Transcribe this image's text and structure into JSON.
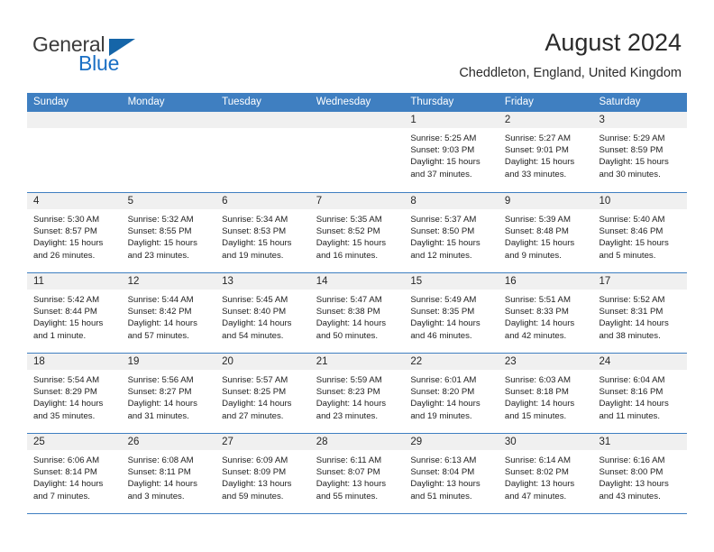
{
  "brand": {
    "word1": "General",
    "word2": "Blue",
    "accent_color": "#1a6fc4",
    "triangle_color": "#1565a8"
  },
  "header": {
    "title": "August 2024",
    "subtitle": "Cheddleton, England, United Kingdom"
  },
  "calendar": {
    "header_bg": "#3f7fc1",
    "daynum_bg": "#f0f0f0",
    "weekdays": [
      "Sunday",
      "Monday",
      "Tuesday",
      "Wednesday",
      "Thursday",
      "Friday",
      "Saturday"
    ],
    "weeks": [
      [
        {
          "day": "",
          "lines": []
        },
        {
          "day": "",
          "lines": []
        },
        {
          "day": "",
          "lines": []
        },
        {
          "day": "",
          "lines": []
        },
        {
          "day": "1",
          "lines": [
            "Sunrise: 5:25 AM",
            "Sunset: 9:03 PM",
            "Daylight: 15 hours",
            "and 37 minutes."
          ]
        },
        {
          "day": "2",
          "lines": [
            "Sunrise: 5:27 AM",
            "Sunset: 9:01 PM",
            "Daylight: 15 hours",
            "and 33 minutes."
          ]
        },
        {
          "day": "3",
          "lines": [
            "Sunrise: 5:29 AM",
            "Sunset: 8:59 PM",
            "Daylight: 15 hours",
            "and 30 minutes."
          ]
        }
      ],
      [
        {
          "day": "4",
          "lines": [
            "Sunrise: 5:30 AM",
            "Sunset: 8:57 PM",
            "Daylight: 15 hours",
            "and 26 minutes."
          ]
        },
        {
          "day": "5",
          "lines": [
            "Sunrise: 5:32 AM",
            "Sunset: 8:55 PM",
            "Daylight: 15 hours",
            "and 23 minutes."
          ]
        },
        {
          "day": "6",
          "lines": [
            "Sunrise: 5:34 AM",
            "Sunset: 8:53 PM",
            "Daylight: 15 hours",
            "and 19 minutes."
          ]
        },
        {
          "day": "7",
          "lines": [
            "Sunrise: 5:35 AM",
            "Sunset: 8:52 PM",
            "Daylight: 15 hours",
            "and 16 minutes."
          ]
        },
        {
          "day": "8",
          "lines": [
            "Sunrise: 5:37 AM",
            "Sunset: 8:50 PM",
            "Daylight: 15 hours",
            "and 12 minutes."
          ]
        },
        {
          "day": "9",
          "lines": [
            "Sunrise: 5:39 AM",
            "Sunset: 8:48 PM",
            "Daylight: 15 hours",
            "and 9 minutes."
          ]
        },
        {
          "day": "10",
          "lines": [
            "Sunrise: 5:40 AM",
            "Sunset: 8:46 PM",
            "Daylight: 15 hours",
            "and 5 minutes."
          ]
        }
      ],
      [
        {
          "day": "11",
          "lines": [
            "Sunrise: 5:42 AM",
            "Sunset: 8:44 PM",
            "Daylight: 15 hours",
            "and 1 minute."
          ]
        },
        {
          "day": "12",
          "lines": [
            "Sunrise: 5:44 AM",
            "Sunset: 8:42 PM",
            "Daylight: 14 hours",
            "and 57 minutes."
          ]
        },
        {
          "day": "13",
          "lines": [
            "Sunrise: 5:45 AM",
            "Sunset: 8:40 PM",
            "Daylight: 14 hours",
            "and 54 minutes."
          ]
        },
        {
          "day": "14",
          "lines": [
            "Sunrise: 5:47 AM",
            "Sunset: 8:38 PM",
            "Daylight: 14 hours",
            "and 50 minutes."
          ]
        },
        {
          "day": "15",
          "lines": [
            "Sunrise: 5:49 AM",
            "Sunset: 8:35 PM",
            "Daylight: 14 hours",
            "and 46 minutes."
          ]
        },
        {
          "day": "16",
          "lines": [
            "Sunrise: 5:51 AM",
            "Sunset: 8:33 PM",
            "Daylight: 14 hours",
            "and 42 minutes."
          ]
        },
        {
          "day": "17",
          "lines": [
            "Sunrise: 5:52 AM",
            "Sunset: 8:31 PM",
            "Daylight: 14 hours",
            "and 38 minutes."
          ]
        }
      ],
      [
        {
          "day": "18",
          "lines": [
            "Sunrise: 5:54 AM",
            "Sunset: 8:29 PM",
            "Daylight: 14 hours",
            "and 35 minutes."
          ]
        },
        {
          "day": "19",
          "lines": [
            "Sunrise: 5:56 AM",
            "Sunset: 8:27 PM",
            "Daylight: 14 hours",
            "and 31 minutes."
          ]
        },
        {
          "day": "20",
          "lines": [
            "Sunrise: 5:57 AM",
            "Sunset: 8:25 PM",
            "Daylight: 14 hours",
            "and 27 minutes."
          ]
        },
        {
          "day": "21",
          "lines": [
            "Sunrise: 5:59 AM",
            "Sunset: 8:23 PM",
            "Daylight: 14 hours",
            "and 23 minutes."
          ]
        },
        {
          "day": "22",
          "lines": [
            "Sunrise: 6:01 AM",
            "Sunset: 8:20 PM",
            "Daylight: 14 hours",
            "and 19 minutes."
          ]
        },
        {
          "day": "23",
          "lines": [
            "Sunrise: 6:03 AM",
            "Sunset: 8:18 PM",
            "Daylight: 14 hours",
            "and 15 minutes."
          ]
        },
        {
          "day": "24",
          "lines": [
            "Sunrise: 6:04 AM",
            "Sunset: 8:16 PM",
            "Daylight: 14 hours",
            "and 11 minutes."
          ]
        }
      ],
      [
        {
          "day": "25",
          "lines": [
            "Sunrise: 6:06 AM",
            "Sunset: 8:14 PM",
            "Daylight: 14 hours",
            "and 7 minutes."
          ]
        },
        {
          "day": "26",
          "lines": [
            "Sunrise: 6:08 AM",
            "Sunset: 8:11 PM",
            "Daylight: 14 hours",
            "and 3 minutes."
          ]
        },
        {
          "day": "27",
          "lines": [
            "Sunrise: 6:09 AM",
            "Sunset: 8:09 PM",
            "Daylight: 13 hours",
            "and 59 minutes."
          ]
        },
        {
          "day": "28",
          "lines": [
            "Sunrise: 6:11 AM",
            "Sunset: 8:07 PM",
            "Daylight: 13 hours",
            "and 55 minutes."
          ]
        },
        {
          "day": "29",
          "lines": [
            "Sunrise: 6:13 AM",
            "Sunset: 8:04 PM",
            "Daylight: 13 hours",
            "and 51 minutes."
          ]
        },
        {
          "day": "30",
          "lines": [
            "Sunrise: 6:14 AM",
            "Sunset: 8:02 PM",
            "Daylight: 13 hours",
            "and 47 minutes."
          ]
        },
        {
          "day": "31",
          "lines": [
            "Sunrise: 6:16 AM",
            "Sunset: 8:00 PM",
            "Daylight: 13 hours",
            "and 43 minutes."
          ]
        }
      ]
    ]
  }
}
